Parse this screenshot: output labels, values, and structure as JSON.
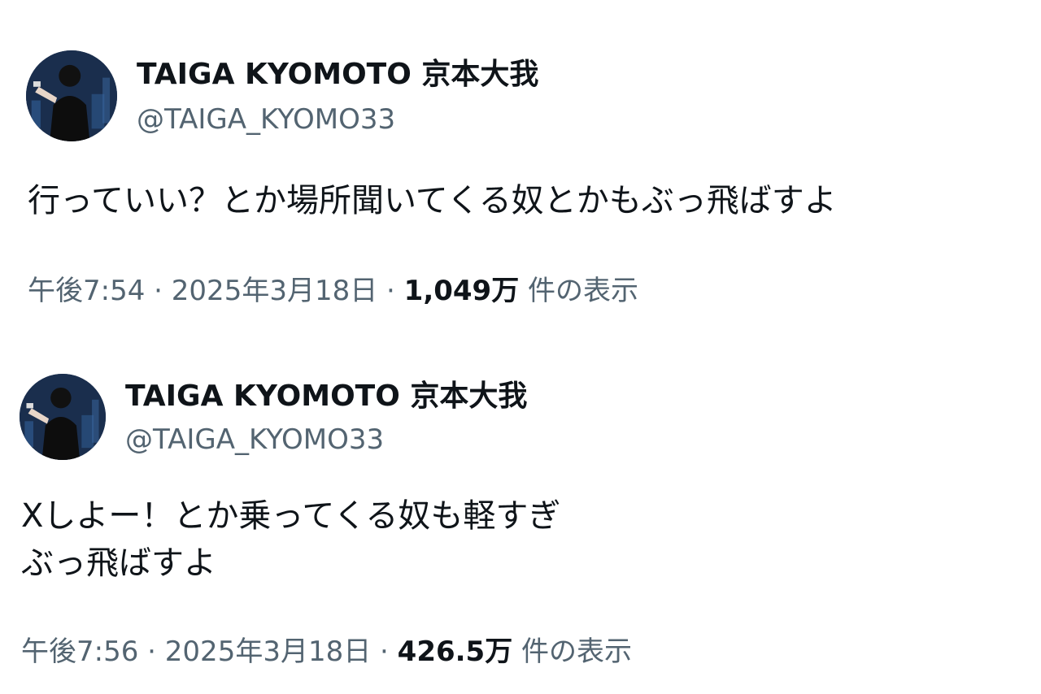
{
  "tweets": [
    {
      "display_name": "TAIGA KYOMOTO 京本大我",
      "handle": "@TAIGA_KYOMO33",
      "avatar_icon": "avatar-photo",
      "text_lines": [
        "行っていい？とか場所聞いてくる奴とかもぶっ飛ばすよ"
      ],
      "time": "午後7:54",
      "date": "2025年3月18日",
      "separator": " · ",
      "views": "1,049万",
      "views_label": " 件の表示"
    },
    {
      "display_name": "TAIGA KYOMOTO 京本大我",
      "handle": "@TAIGA_KYOMO33",
      "avatar_icon": "avatar-photo",
      "text_lines": [
        "Xしよー！とか乗ってくる奴も軽すぎ",
        "ぶっ飛ばすよ"
      ],
      "time": "午後7:56",
      "date": "2025年3月18日",
      "separator": " · ",
      "views": "426.5万",
      "views_label": " 件の表示"
    }
  ],
  "colors": {
    "primary_text": "#0f1419",
    "secondary_text": "#536471",
    "background": "#ffffff"
  }
}
